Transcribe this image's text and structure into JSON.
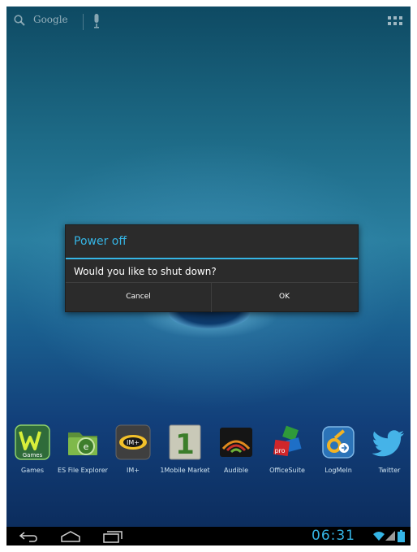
{
  "search": {
    "label": "Google"
  },
  "dialog": {
    "title": "Power off",
    "message": "Would you like to shut down?",
    "cancel_label": "Cancel",
    "ok_label": "OK",
    "accent_color": "#35b5e5"
  },
  "dock": {
    "apps": [
      {
        "label": "Games",
        "icon": "games-icon",
        "badge": "Games"
      },
      {
        "label": "ES File Explorer",
        "icon": "es-file-explorer-icon"
      },
      {
        "label": "IM+",
        "icon": "im-plus-icon",
        "badge": "IM+"
      },
      {
        "label": "1Mobile Market",
        "icon": "1mobile-market-icon",
        "badge": "1"
      },
      {
        "label": "Audible",
        "icon": "audible-icon"
      },
      {
        "label": "OfficeSuite",
        "icon": "officesuite-icon",
        "badge": "pro"
      },
      {
        "label": "LogMeIn",
        "icon": "logmein-icon"
      },
      {
        "label": "Twitter",
        "icon": "twitter-icon"
      }
    ]
  },
  "status": {
    "time": "06:31"
  },
  "icons": {
    "search": "search-icon",
    "mic": "microphone-icon",
    "apps": "all-apps-icon",
    "back": "back-icon",
    "home": "home-icon",
    "recents": "recent-apps-icon",
    "wifi": "wifi-icon",
    "signal": "signal-icon",
    "battery": "battery-icon"
  }
}
